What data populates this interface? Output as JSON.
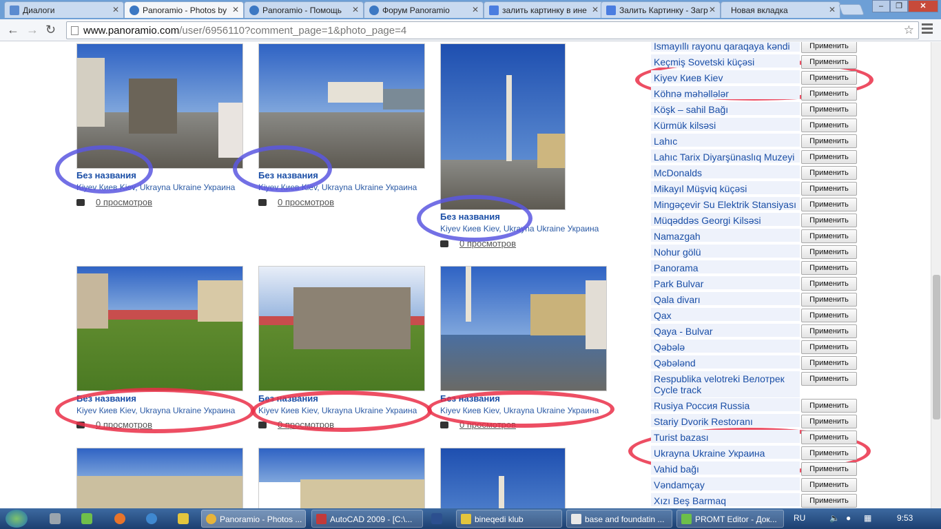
{
  "browser": {
    "tabs": [
      {
        "label": "Диалоги"
      },
      {
        "label": "Panoramio - Photos by"
      },
      {
        "label": "Panoramio - Помощь"
      },
      {
        "label": "Форум Panoramio"
      },
      {
        "label": "залить картинку в ине"
      },
      {
        "label": "Залить Картинку - Загр"
      },
      {
        "label": "Новая вкладка"
      }
    ],
    "url_host": "www.panoramio.com",
    "url_path": "/user/6956110?comment_page=1&photo_page=4"
  },
  "photos": [
    {
      "title": "Без названия",
      "location": "Kiyev Киев Kiev, Ukrayna Ukraine Украина",
      "views": "0 просмотров"
    },
    {
      "title": "Без названия",
      "location": "Kiyev Киев Kiev, Ukrayna Ukraine Украина",
      "views": "0 просмотров"
    },
    {
      "title": "Без названия",
      "location": "Kiyev Киев Kiev, Ukrayna Ukraine Украина",
      "views": "0 просмотров"
    },
    {
      "title": "Без названия",
      "location": "Kiyev Киев Kiev, Ukrayna Ukraine Украина",
      "views": "0 просмотров"
    },
    {
      "title": "Без названия",
      "location": "Kiyev Киев Kiev, Ukrayna Ukraine Украина",
      "views": "0 просмотров"
    },
    {
      "title": "Без названия",
      "location": "Kiyev Киев Kiev, Ukrayna Ukraine Украина",
      "views": "0 просмотров"
    }
  ],
  "apply_label": "Применить",
  "tags": [
    "İsmayıllı rayonu qaraqaya kəndi",
    "Keçmiş Sovetski küçəsi",
    "Kiyev Киев Kiev",
    "Köhnə məhəllələr",
    "Köşk – sahil Bağı",
    "Kürmük kilsəsi",
    "Lahıc",
    "Lahıc Tarix Diyarşünaslıq Muzeyi",
    "McDonalds",
    "Mikayıl Müşviq küçəsi",
    "Mingəçevir Su Elektrik Stansiyası",
    "Müqəddəs Georgi Kilsəsi",
    "Namazgah",
    "Nohur gölü",
    "Panorama",
    "Park Bulvar",
    "Qala divarı",
    "Qax",
    "Qaya - Bulvar",
    "Qəbələ",
    "Qəbələnd",
    "Respublika velotreki Велотрек Cycle track",
    "Rusiya Россия Russia",
    "Stariy Dvorik Restoranı",
    "Turist bazası",
    "Ukrayna Ukraine Украина",
    "Vahid bağı",
    "Vəndamçay",
    "Xızı Beş Barmaq"
  ],
  "taskbar": {
    "items": [
      "Panoramio - Photos ...",
      "AutoCAD 2009 - [C:\\...",
      "bineqedi klub",
      "base and foundatin ...",
      "PROMT Editor - Док..."
    ],
    "lang": "RU",
    "clock": "9:53"
  },
  "colors": {
    "accent": "#1a4ea6",
    "annotation_blue": "#5b57e0",
    "annotation_red": "#ea2f48"
  }
}
